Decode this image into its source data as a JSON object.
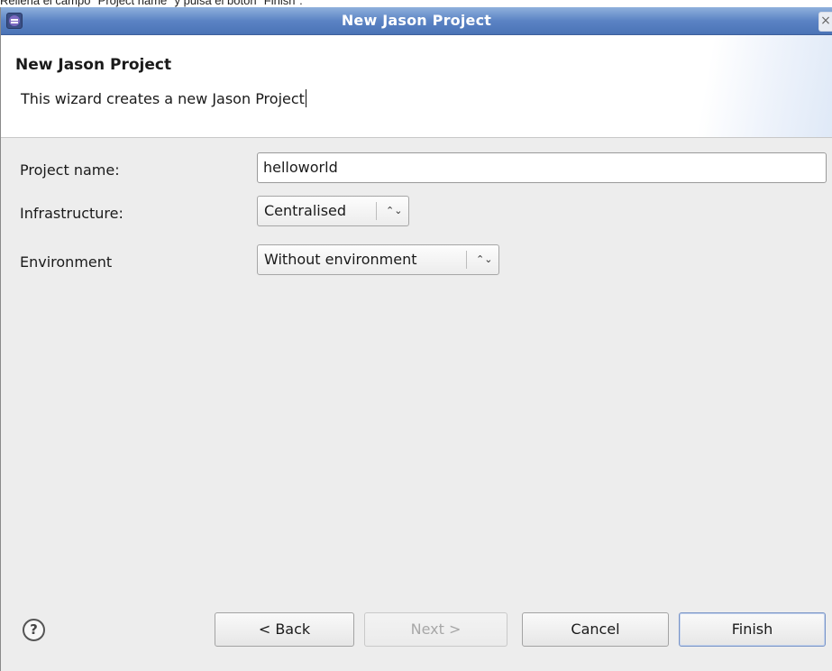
{
  "caption": "Rellena el campo \"Project name\" y pulsa el botón \"Finish\".",
  "window": {
    "title": "New Jason Project",
    "close_glyph": "×"
  },
  "header": {
    "title": "New Jason Project",
    "description": "This wizard creates a new Jason Project"
  },
  "form": {
    "project_name": {
      "label": "Project name:",
      "value": "helloworld"
    },
    "infrastructure": {
      "label": "Infrastructure:",
      "value": "Centralised"
    },
    "environment": {
      "label": "Environment",
      "value": "Without environment"
    }
  },
  "footer": {
    "help_glyph": "?",
    "back_label": "< Back",
    "next_label": "Next >",
    "cancel_label": "Cancel",
    "finish_label": "Finish"
  },
  "icons": {
    "app": "eclipse-icon",
    "help": "help-icon",
    "close": "close-icon",
    "combo": "up-down-arrows-icon"
  },
  "colors": {
    "titlebar": "#5b83c4",
    "dialog_body": "#ededed",
    "header_bg": "#ffffff"
  }
}
